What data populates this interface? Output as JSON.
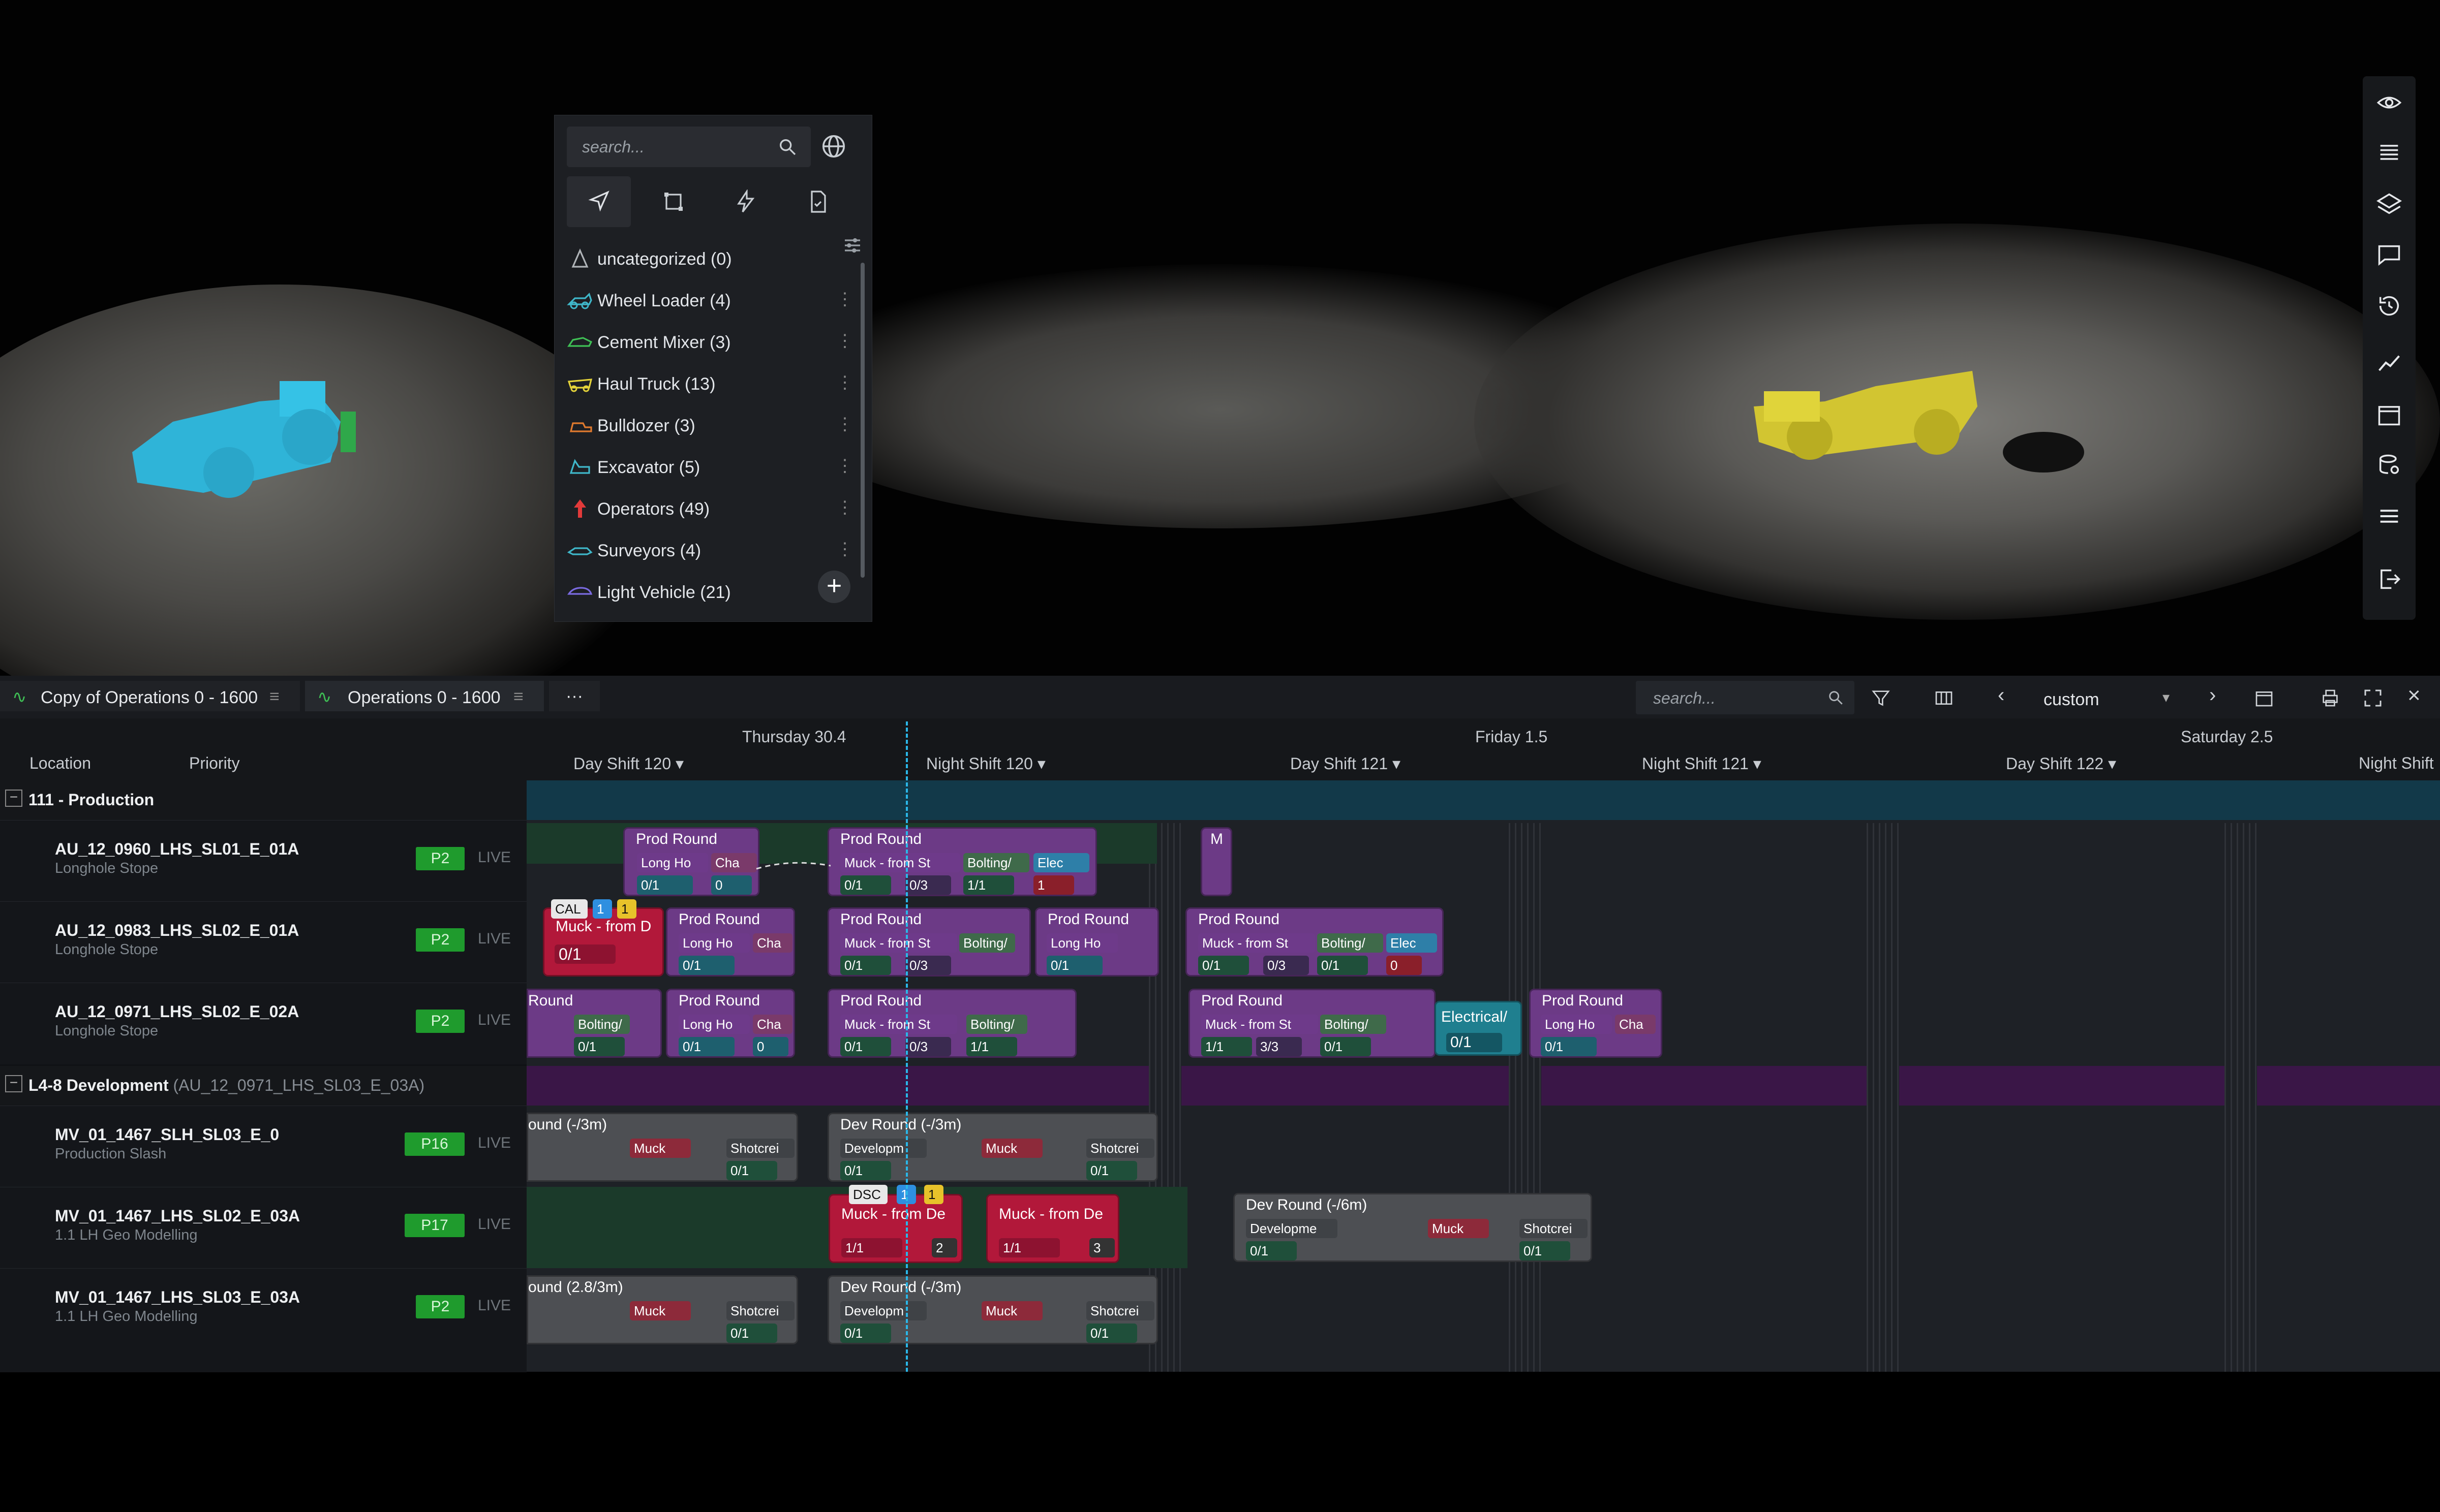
{
  "layers_panel": {
    "search_placeholder": "search...",
    "categories": [
      {
        "label": "uncategorized (0)",
        "icon": "warning-triangle-icon",
        "color": "#b0b4b8"
      },
      {
        "label": "Wheel Loader (4)",
        "icon": "wheel-loader-icon",
        "color": "#3fb7c9"
      },
      {
        "label": "Cement Mixer (3)",
        "icon": "cement-mixer-icon",
        "color": "#3fbf55"
      },
      {
        "label": "Haul Truck (13)",
        "icon": "haul-truck-icon",
        "color": "#e4d33a"
      },
      {
        "label": "Bulldozer (3)",
        "icon": "bulldozer-icon",
        "color": "#e07a2e"
      },
      {
        "label": "Excavator (5)",
        "icon": "excavator-icon",
        "color": "#3fb7c9"
      },
      {
        "label": "Operators (49)",
        "icon": "operator-icon",
        "color": "#e23a3a"
      },
      {
        "label": "Surveyors (4)",
        "icon": "surveyor-icon",
        "color": "#3fb7c9"
      },
      {
        "label": "Light Vehicle (21)",
        "icon": "light-vehicle-icon",
        "color": "#7a6ae0"
      }
    ]
  },
  "schedule": {
    "tabs": [
      {
        "label": "Copy of Operations 0 - 1600"
      },
      {
        "label": "Operations 0 - 1600"
      }
    ],
    "more_tabs": "···",
    "search_placeholder": "search...",
    "range_select": "custom",
    "columns": {
      "location": "Location",
      "priority": "Priority"
    },
    "days": [
      {
        "label": "Thursday 30.4"
      },
      {
        "label": "Friday 1.5"
      },
      {
        "label": "Saturday 2.5"
      }
    ],
    "shifts": [
      {
        "label": "Day Shift 120 ▾"
      },
      {
        "label": "Night Shift 120 ▾"
      },
      {
        "label": "Day Shift 121 ▾"
      },
      {
        "label": "Night Shift 121 ▾"
      },
      {
        "label": "Day Shift 122 ▾"
      },
      {
        "label": "Night Shift"
      }
    ],
    "groups": [
      {
        "label": "111 - Production",
        "sub": ""
      },
      {
        "label": "L4-8 Development",
        "sub": "(AU_12_0971_LHS_SL03_E_03A)"
      }
    ],
    "rows": [
      {
        "name": "AU_12_0960_LHS_SL01_E_01A",
        "sub": "Longhole Stope",
        "priority": "P2",
        "status": "LIVE"
      },
      {
        "name": "AU_12_0983_LHS_SL02_E_01A",
        "sub": "Longhole Stope",
        "priority": "P2",
        "status": "LIVE"
      },
      {
        "name": "AU_12_0971_LHS_SL02_E_02A",
        "sub": "Longhole Stope",
        "priority": "P2",
        "status": "LIVE"
      },
      {
        "name": "MV_01_1467_SLH_SL03_E_0",
        "sub": "Production Slash",
        "priority": "P16",
        "status": "LIVE"
      },
      {
        "name": "MV_01_1467_LHS_SL02_E_03A",
        "sub": "1.1 LH Geo Modelling",
        "priority": "P17",
        "status": "LIVE"
      },
      {
        "name": "MV_01_1467_LHS_SL03_E_03A",
        "sub": "1.1 LH Geo Modelling",
        "priority": "P2",
        "status": "LIVE"
      }
    ],
    "cards": {
      "prod_round": "Prod Round",
      "long_hole": "Long Ho",
      "charge": "Cha",
      "muck_from_stope": "Muck - from St",
      "bolting": "Bolting/",
      "electrical": "Elec",
      "electrical_full": "Electrical/",
      "muck_from_dev": "Muck - from De",
      "muck_from_d": "Muck - from D",
      "dev_round_3m": "Dev Round (-/3m)",
      "dev_round_6m": "Dev Round (-/6m)",
      "round_3m": "ound (-/3m)",
      "round_28": "ound (2.8/3m)",
      "development": "Developm",
      "development2": "Developme",
      "muck": "Muck",
      "shotcrete": "Shotcrei",
      "m": "M",
      "round": "Round",
      "counts": [
        "0/1",
        "0/3",
        "1/1",
        "1",
        "0",
        "0/1",
        "2",
        "3/3",
        "1/1",
        "3"
      ],
      "badges": {
        "cal": "CAL",
        "dsc": "DSC",
        "one": "1"
      }
    }
  }
}
